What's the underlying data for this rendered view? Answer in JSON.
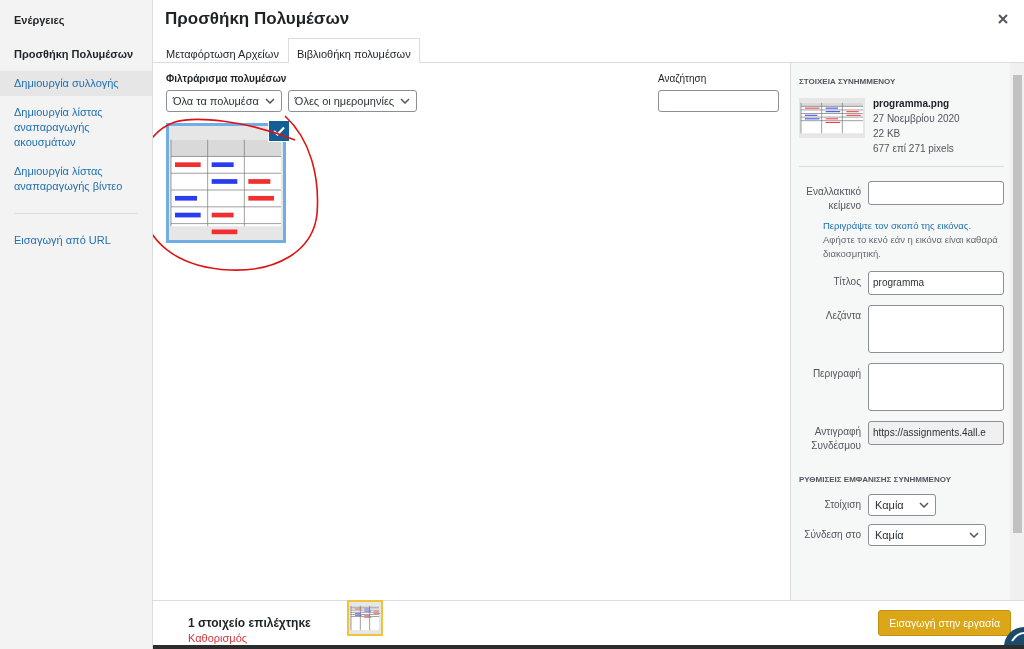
{
  "sidebar": {
    "heading": "Ενέργειες",
    "items": [
      {
        "label": "Προσθήκη Πολυμέσων",
        "selected": true,
        "hovered": false
      },
      {
        "label": "Δημιουργία συλλογής",
        "selected": false,
        "hovered": true
      },
      {
        "label": "Δημιουργία λίστας αναπαραγωγής ακουσμάτων",
        "selected": false,
        "hovered": false
      },
      {
        "label": "Δημιουργία λίστας αναπαραγωγής βίντεο",
        "selected": false,
        "hovered": false
      }
    ],
    "extra_items": [
      {
        "label": "Εισαγωγή από URL",
        "selected": false,
        "hovered": false
      }
    ]
  },
  "modal": {
    "title": "Προσθήκη Πολυμέσων"
  },
  "tabs": [
    {
      "label": "Μεταφόρτωση Αρχείων",
      "selected": false
    },
    {
      "label": "Βιβλιοθήκη πολυμέσων",
      "selected": true
    }
  ],
  "filters": {
    "label": "Φιλτράρισμα πολυμέσων",
    "type_select": "Όλα τα πολυμέσα",
    "date_select": "Όλες οι ημερομηνίες"
  },
  "search": {
    "label": "Αναζήτηση"
  },
  "attachments": [
    {
      "kind": "picture",
      "selected": true
    }
  ],
  "details": {
    "heading": "ΣΤΟΙΧΕΙΑ ΣΥΝΗΜΜΕΝΟΥ",
    "filename": "programma.png",
    "date": "27 Νοεμβρίου 2020",
    "size": "22 KB",
    "dimensions": "677 επί 271 pixels",
    "fields": [
      {
        "kind": "input",
        "label": "Εναλλακτικό κείμενο",
        "help_link": "Περιγράψτε τον σκοπό της εικόνας",
        "help_text": ". Αφήστε το κενό εάν η εικόνα είναι καθαρά διακοσμητική."
      },
      {
        "kind": "input",
        "label": "Τίτλος",
        "value": "programma"
      },
      {
        "kind": "textarea",
        "label": "Λεζάντα"
      },
      {
        "kind": "textarea",
        "label": "Περιγραφή"
      },
      {
        "kind": "readonly",
        "label": "Αντιγραφή Συνδέσμου",
        "value": "https://assignments.4all.e"
      }
    ]
  },
  "display_settings": {
    "heading": "ΡΥΘΜΙΣΕΙΣ ΕΜΦΑΝΙΣΗΣ ΣΥΝΗΜΜΕΝΟΥ",
    "rows": [
      {
        "label": "Στοίχιση",
        "value": "Καμία",
        "wide": false
      },
      {
        "label": "Σύνδεση στο",
        "value": "Καμία",
        "wide": true
      }
    ]
  },
  "toolbar": {
    "selection_count": "1 στοιχείο επιλέχτηκε",
    "clear_link": "Καθορισμός",
    "insert_button": "Εισαγωγή στην εργασία"
  }
}
